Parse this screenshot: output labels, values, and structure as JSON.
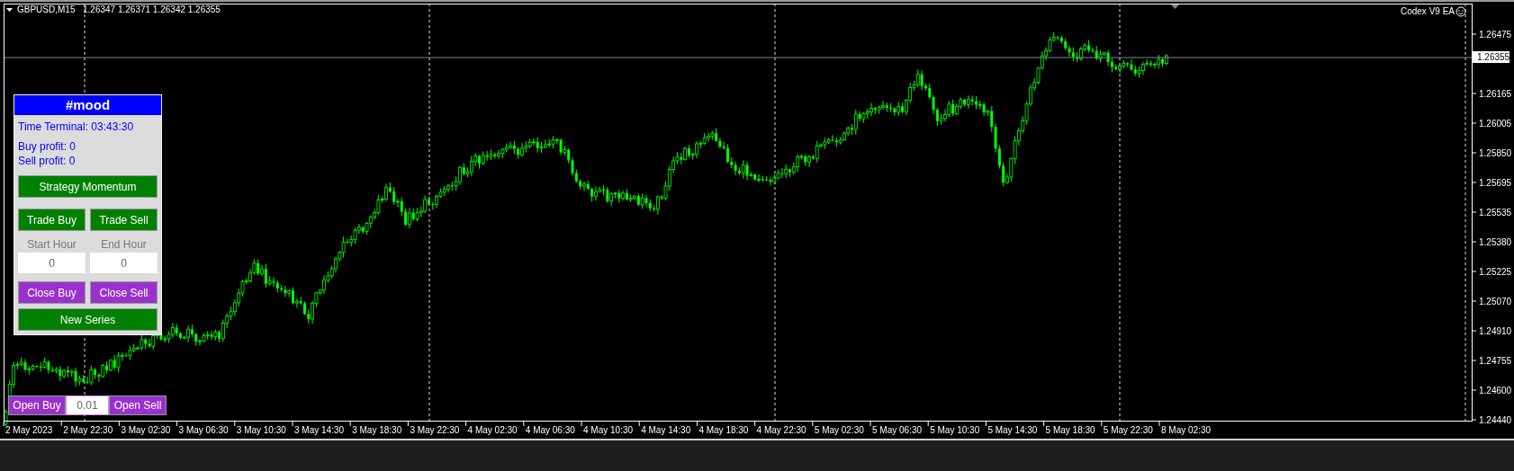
{
  "chart": {
    "symbol": "GBPUSD,M15",
    "ohlc": "1.26347 1.26371 1.26342 1.26355",
    "expert": "Codex V9 EA",
    "current_price": "1.26355",
    "price_axis": [
      "1.26475",
      "1.26165",
      "1.26005",
      "1.25850",
      "1.25695",
      "1.25535",
      "1.25380",
      "1.25225",
      "1.25070",
      "1.24910",
      "1.24755",
      "1.24600",
      "1.24440"
    ],
    "time_axis": [
      "2 May 2023",
      "2 May 22:30",
      "3 May 02:30",
      "3 May 06:30",
      "3 May 10:30",
      "3 May 14:30",
      "3 May 18:30",
      "3 May 22:30",
      "4 May 02:30",
      "4 May 06:30",
      "4 May 10:30",
      "4 May 14:30",
      "4 May 18:30",
      "4 May 22:30",
      "5 May 02:30",
      "5 May 06:30",
      "5 May 10:30",
      "5 May 14:30",
      "5 May 18:30",
      "5 May 22:30",
      "8 May 02:30"
    ]
  },
  "panel": {
    "title": "#mood",
    "time": "Time Terminal: 03:43:30",
    "buy_profit": "Buy profit: 0",
    "sell_profit": "Sell profit: 0",
    "strategy_button": "Strategy Momentum",
    "trade_buttons": [
      "Trade Buy",
      "Trade Sell"
    ],
    "hours": [
      {
        "label": "Start Hour",
        "value": "0"
      },
      {
        "label": "End Hour",
        "value": "0"
      }
    ],
    "close_buttons": [
      "Close Buy",
      "Close Sell"
    ],
    "new_series_button": "New Series"
  },
  "order_bar": {
    "buy_button": "Open Buy",
    "lot": "0.01",
    "sell_button": "Open Sell"
  }
}
